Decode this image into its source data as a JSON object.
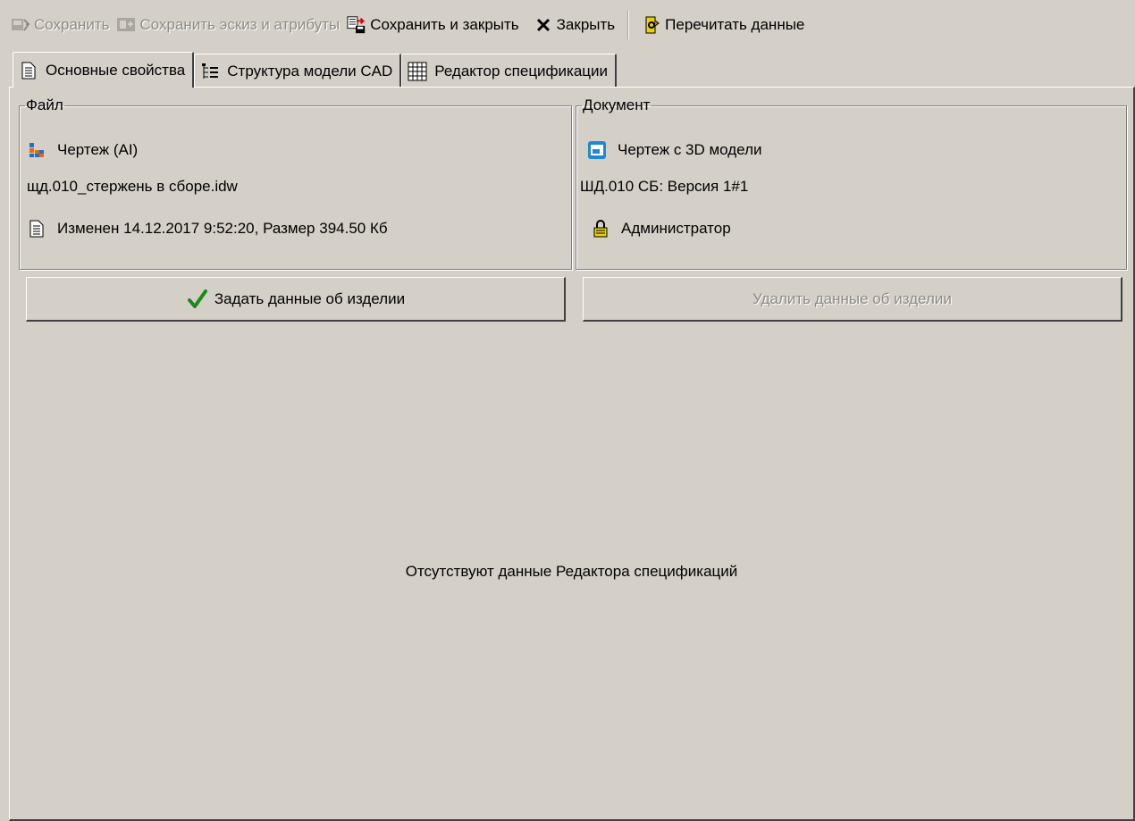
{
  "toolbar": {
    "save": "Сохранить",
    "save_sketch": "Сохранить эскиз и атрибуты",
    "save_close": "Сохранить и закрыть",
    "close": "Закрыть",
    "reread": "Перечитать данные"
  },
  "tabs": [
    {
      "label": "Основные свойства",
      "icon": "document-icon"
    },
    {
      "label": "Структура модели CAD",
      "icon": "tree-structure-icon"
    },
    {
      "label": "Редактор спецификации",
      "icon": "table-grid-icon"
    }
  ],
  "file_group": {
    "legend": "Файл",
    "type": "Чертеж (AI)",
    "name": "щд.010_стержень в сборе.idw",
    "info": "Изменен 14.12.2017 9:52:20, Размер 394.50 Кб"
  },
  "document_group": {
    "legend": "Документ",
    "type": "Чертеж с 3D модели",
    "designation": "ШД.010 СБ: Версия 1#1",
    "owner": "Администратор"
  },
  "buttons": {
    "set_product": "Задать данные об изделии",
    "delete_product": "Удалить данные об изделии"
  },
  "empty_message": "Отсутствуют данные Редактора спецификаций",
  "colors": {
    "background": "#d4d0c8",
    "disabled_text": "#8e8b86",
    "accent_blue": "#1e88d6",
    "check_green": "#1a8a1a",
    "lock_yellow": "#e8d200"
  }
}
